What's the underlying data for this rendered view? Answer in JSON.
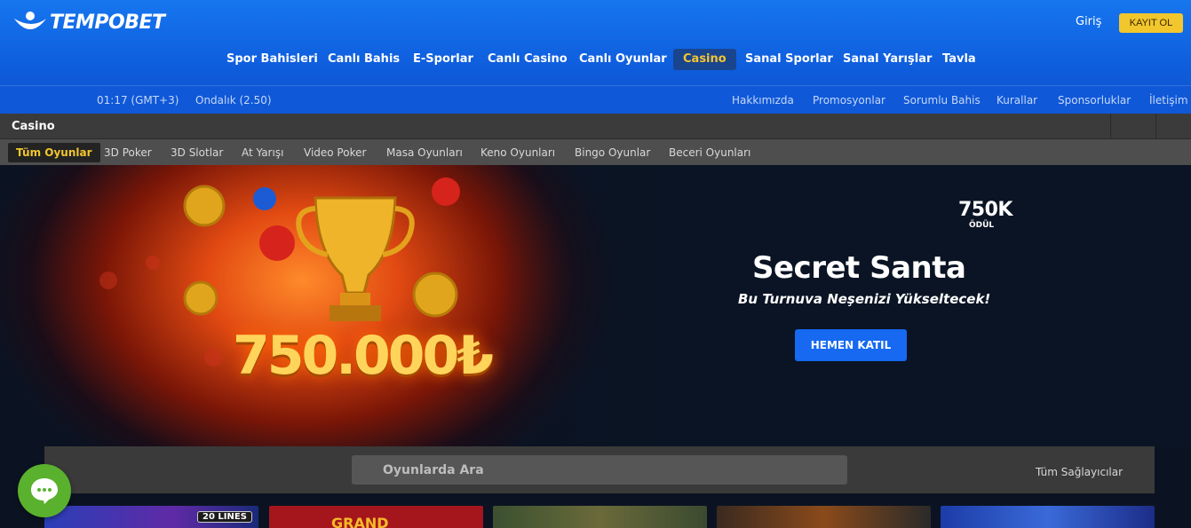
{
  "header": {
    "logo_text": "TEMPOBET",
    "login_label": "Giriş",
    "register_label": "KAYIT OL",
    "nav": [
      "Spor Bahisleri",
      "Canlı Bahis",
      "E-Sporlar",
      "Canlı Casino",
      "Canlı Oyunlar",
      "Casino",
      "Sanal Sporlar",
      "Sanal Yarışlar",
      "Tavla"
    ],
    "active_nav": "Casino",
    "time": "01:17 (GMT+3)",
    "odds_format": "Ondalık (2.50)",
    "info_links": [
      "Hakkımızda",
      "Promosyonlar",
      "Sorumlu Bahis",
      "Kurallar",
      "Sponsorluklar",
      "İletişim"
    ]
  },
  "casino": {
    "title": "Casino",
    "tabs": [
      "Tüm Oyunlar",
      "3D Poker",
      "3D Slotlar",
      "At Yarışı",
      "Video Poker",
      "Masa Oyunları",
      "Keno Oyunları",
      "Bingo Oyunlar",
      "Beceri Oyunları"
    ],
    "active_tab": "Tüm Oyunlar"
  },
  "banner": {
    "prize_amount_image": "750.000₺",
    "prize_short": "750K",
    "prize_label": "ÖDÜL",
    "title": "Secret Santa",
    "subtitle": "Bu Turnuva Neşenizi Yükseltecek!",
    "cta_label": "HEMEN KATIL"
  },
  "search": {
    "placeholder": "Oyunlarda Ara",
    "providers_label": "Tüm Sağlayıcılar"
  },
  "games": {
    "partial_labels": [
      "20 LINES",
      "GRAND"
    ]
  },
  "colors": {
    "brand_blue": "#1166e8",
    "accent_yellow": "#f2c62d",
    "cta_blue": "#1669f0",
    "chat_green": "#5ab12d"
  },
  "icons": {
    "chat": "chat-bubble-icon",
    "logo": "swoosh-logo-icon"
  }
}
